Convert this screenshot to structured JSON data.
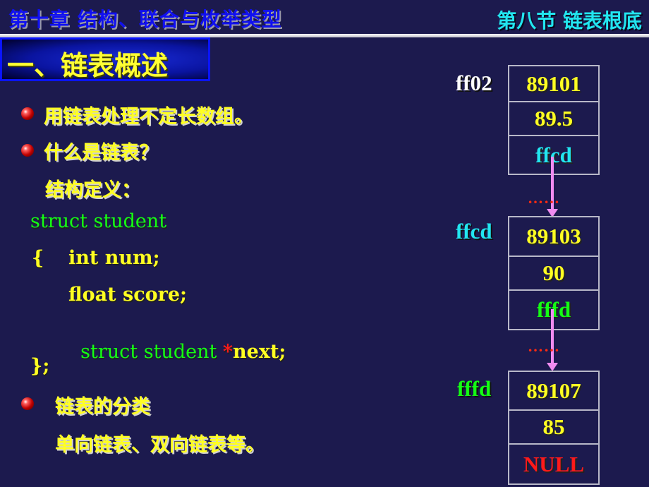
{
  "header": {
    "chapter_title": "第十章  结构、联合与枚举类型",
    "section_title": "第八节  链表根底"
  },
  "heading": "一、链表概述",
  "bullets": [
    {
      "text": "用链表处理不定长数组。"
    },
    {
      "text": "什么是链表？"
    }
  ],
  "struct_label": "结构定义：",
  "code": {
    "line1": "struct student",
    "line2_brace": "{",
    "line2_code": "int num;",
    "line3": "float score;",
    "line4_type": "struct student ",
    "line4_star": "*",
    "line4_name": "next;",
    "line5": "};"
  },
  "classification": {
    "title": "链表的分类",
    "detail": "单向链表、双向链表等。"
  },
  "colors": {
    "background": "#1c1a4e",
    "yellow": "#ffff22",
    "green": "#14ff14",
    "cyan": "#22e6f0",
    "red": "#ff1a1a",
    "arrow": "#f08cf0"
  },
  "linked_list": {
    "nodes": [
      {
        "address": "ff02",
        "num": "89101",
        "score": "89.5",
        "next": "ffcd"
      },
      {
        "address": "ffcd",
        "num": "89103",
        "score": "90",
        "next": "fffd"
      },
      {
        "address": "fffd",
        "num": "89107",
        "score": "85",
        "next": "NULL"
      }
    ],
    "ellipsis": "……"
  }
}
